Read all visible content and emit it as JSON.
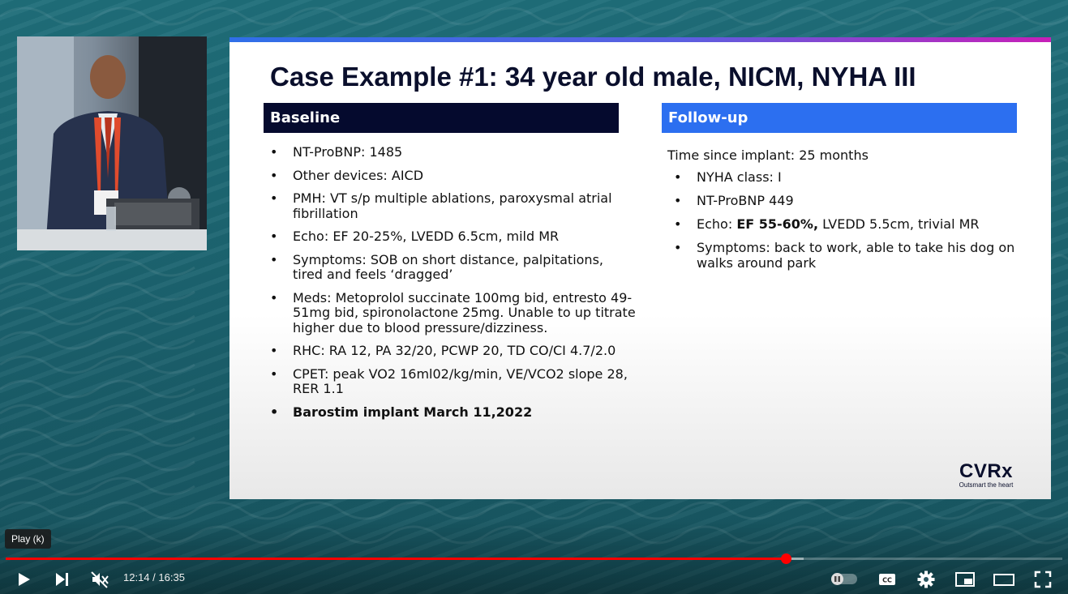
{
  "slide": {
    "title": "Case Example #1: 34 year old male, NICM, NYHA III",
    "baseline": {
      "heading": "Baseline",
      "items": [
        "NT-ProBNP: 1485",
        "Other devices: AICD",
        "PMH: VT s/p multiple ablations, paroxysmal atrial fibrillation",
        "Echo: EF 20-25%, LVEDD 6.5cm, mild MR",
        "Symptoms: SOB on short distance, palpitations, tired and feels ‘dragged’",
        "Meds: Metoprolol succinate 100mg bid, entresto 49-51mg bid, spironolactone 25mg. Unable to up titrate higher due to blood pressure/dizziness.",
        "RHC: RA 12, PA 32/20, PCWP 20, TD CO/CI 4.7/2.0",
        "CPET: peak VO2 16ml02/kg/min, VE/VCO2 slope 28, RER 1.1",
        "Barostim implant March 11,2022"
      ]
    },
    "followup": {
      "heading": "Follow-up",
      "intro": "Time since implant: 25 months",
      "items": [
        "NYHA class: I",
        "NT-ProBNP 449",
        "",
        "Symptoms: back to work, able to take his dog on walks around park"
      ],
      "echo_prefix": "Echo: ",
      "echo_bold": "EF 55-60%,",
      "echo_rest": " LVEDD 5.5cm, trivial MR"
    },
    "logo": {
      "word": "CVRx",
      "tagline": "Outsmart the heart"
    }
  },
  "player": {
    "tooltip": "Play (k)",
    "current_time": "12:14",
    "separator": " / ",
    "duration": "16:35",
    "progress_fraction": 0.738,
    "buffer_fraction": 0.755,
    "icons": {
      "play": "play-icon",
      "next": "next-icon",
      "mute": "muted-icon",
      "autoplay": "autoplay-toggle-icon",
      "captions": "captions-icon",
      "settings": "gear-icon",
      "miniplayer": "miniplayer-icon",
      "theater": "theater-mode-icon",
      "fullscreen": "fullscreen-icon"
    },
    "accent_color": "#ff0000"
  }
}
